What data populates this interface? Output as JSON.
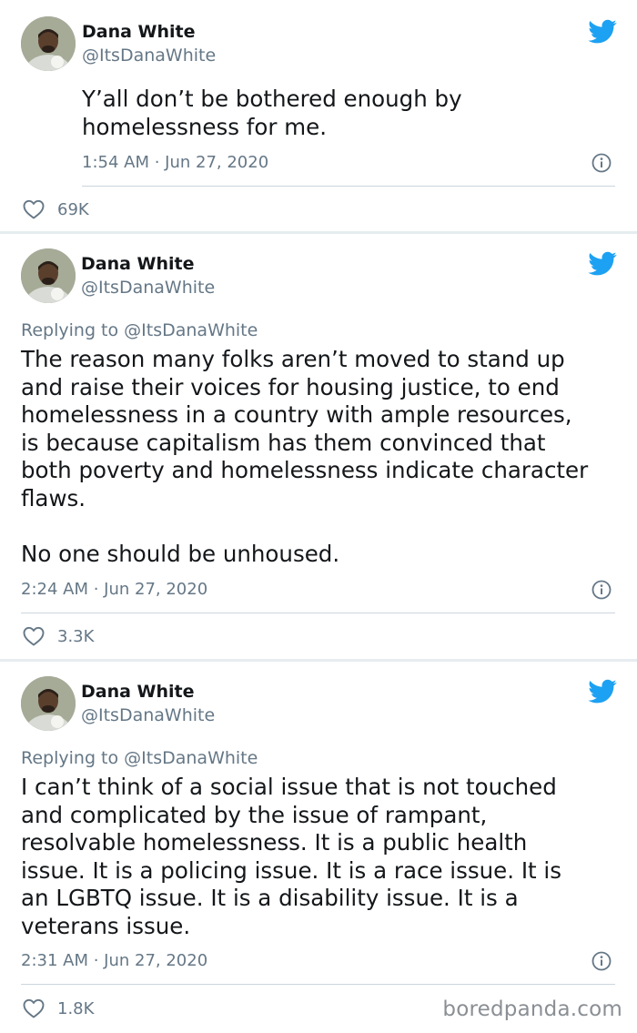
{
  "tweets": [
    {
      "author": {
        "name": "Dana White",
        "handle": "@ItsDanaWhite"
      },
      "replying_to": "",
      "text": "Y’all don’t be bothered enough by\nhomelessness for me.",
      "timestamp": "1:54 AM · Jun 27, 2020",
      "likes": "69K",
      "icons": {
        "platform": "twitter-bird-icon",
        "info": "info-icon",
        "like": "heart-icon"
      }
    },
    {
      "author": {
        "name": "Dana White",
        "handle": "@ItsDanaWhite"
      },
      "replying_to": "Replying to @ItsDanaWhite",
      "text": "The reason many folks aren’t moved to stand up\nand raise their voices for housing justice, to end\nhomelessness in a country with ample resources,\nis because capitalism has them convinced that\nboth poverty and homelessness indicate character\nflaws.\n\nNo one should be unhoused.",
      "timestamp": "2:24 AM · Jun 27, 2020",
      "likes": "3.3K",
      "icons": {
        "platform": "twitter-bird-icon",
        "info": "info-icon",
        "like": "heart-icon"
      }
    },
    {
      "author": {
        "name": "Dana White",
        "handle": "@ItsDanaWhite"
      },
      "replying_to": "Replying to @ItsDanaWhite",
      "text": "I can’t think of a social issue that is not touched\nand complicated by the issue of rampant,\nresolvable homelessness. It is a public health\nissue. It is a policing issue. It is a race issue. It is\nan LGBTQ issue. It is a disability issue. It is a\nveterans issue.",
      "timestamp": "2:31 AM · Jun 27, 2020",
      "likes": "1.8K",
      "icons": {
        "platform": "twitter-bird-icon",
        "info": "info-icon",
        "like": "heart-icon"
      }
    }
  ],
  "watermark": "boredpanda.com",
  "colors": {
    "brand_blue": "#1da1f2",
    "text_primary": "#14171a",
    "text_secondary": "#657786",
    "divider": "#ccd6dd",
    "page_gap": "#e6ecf0"
  }
}
